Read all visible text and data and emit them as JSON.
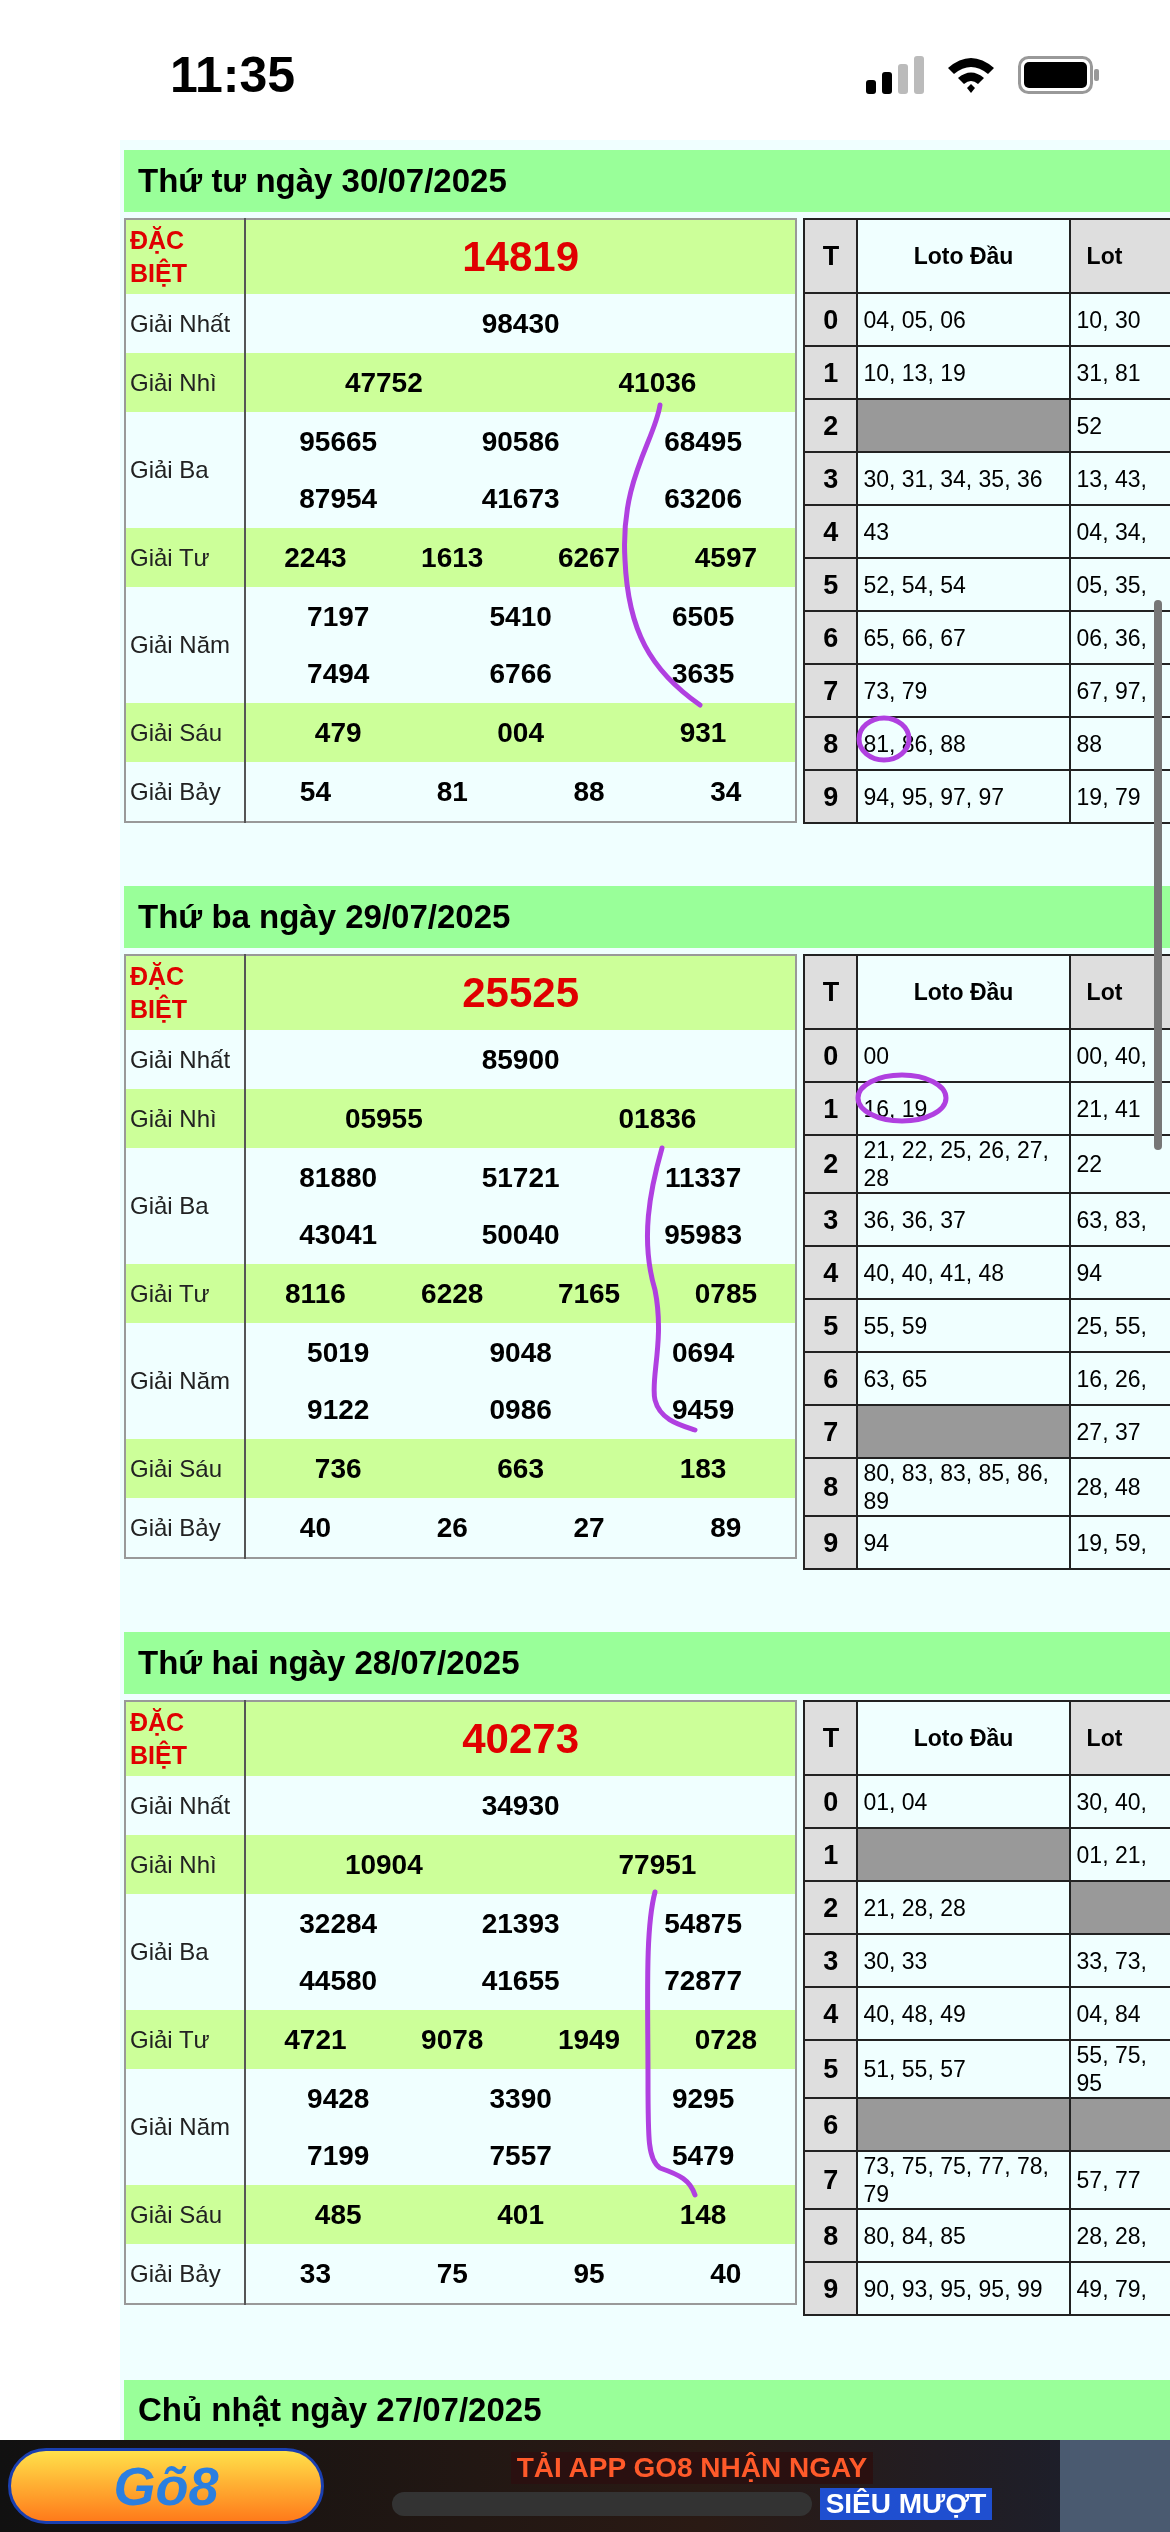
{
  "status_bar": {
    "time": "11:35"
  },
  "sections": [
    {
      "date": "Thứ tư ngày 30/07/2025",
      "prizes": [
        {
          "kind": "special",
          "label": "ĐẶC BIỆT",
          "numbers": [
            "14819"
          ]
        },
        {
          "kind": "normal",
          "label": "Giải Nhất",
          "numbers": [
            "98430"
          ]
        },
        {
          "kind": "normal",
          "label": "Giải Nhì",
          "numbers": [
            "47752",
            "41036"
          ]
        },
        {
          "kind": "normal",
          "label": "Giải Ba",
          "numbers": [
            "95665",
            "90586",
            "68495",
            "87954",
            "41673",
            "63206"
          ]
        },
        {
          "kind": "normal",
          "label": "Giải Tư",
          "numbers": [
            "2243",
            "1613",
            "6267",
            "4597"
          ]
        },
        {
          "kind": "normal",
          "label": "Giải Năm",
          "numbers": [
            "7197",
            "5410",
            "6505",
            "7494",
            "6766",
            "3635"
          ]
        },
        {
          "kind": "normal",
          "label": "Giải Sáu",
          "numbers": [
            "479",
            "004",
            "931"
          ]
        },
        {
          "kind": "normal",
          "label": "Giải Bảy",
          "numbers": [
            "54",
            "81",
            "88",
            "34"
          ]
        }
      ],
      "loto": {
        "columns": [
          "T",
          "Loto Đầu",
          "Lot"
        ],
        "rows": [
          {
            "t": "0",
            "head": "04, 05, 06",
            "tail": [
              "10, 30"
            ]
          },
          {
            "t": "1",
            "head": "10, 13, 19",
            "tail": [
              "31, 81"
            ]
          },
          {
            "t": "2",
            "tail": [
              "52"
            ]
          },
          {
            "t": "3",
            "head": "30, 31, 34, 35, 36",
            "tail": [
              "13, 43,"
            ]
          },
          {
            "t": "4",
            "head": "43",
            "tail": [
              "04, 34,"
            ]
          },
          {
            "t": "5",
            "head": "52, 54, 54",
            "tail": [
              "05, 35,"
            ]
          },
          {
            "t": "6",
            "head": "65, 66, 67",
            "tail": [
              "06, 36,"
            ]
          },
          {
            "t": "7",
            "head": "73, 79",
            "tail": [
              "67, 97,"
            ]
          },
          {
            "t": "8",
            "head": "81, 86, 88",
            "tail": [
              "88"
            ]
          },
          {
            "t": "9",
            "head": "94, 95, 97, 97",
            "tail": [
              "19, 79"
            ]
          }
        ]
      }
    },
    {
      "date": "Thứ ba ngày 29/07/2025",
      "prizes": [
        {
          "kind": "special",
          "label": "ĐẶC BIỆT",
          "numbers": [
            "25525"
          ]
        },
        {
          "kind": "normal",
          "label": "Giải Nhất",
          "numbers": [
            "85900"
          ]
        },
        {
          "kind": "normal",
          "label": "Giải Nhì",
          "numbers": [
            "05955",
            "01836"
          ]
        },
        {
          "kind": "normal",
          "label": "Giải Ba",
          "numbers": [
            "81880",
            "51721",
            "11337",
            "43041",
            "50040",
            "95983"
          ]
        },
        {
          "kind": "normal",
          "label": "Giải Tư",
          "numbers": [
            "8116",
            "6228",
            "7165",
            "0785"
          ]
        },
        {
          "kind": "normal",
          "label": "Giải Năm",
          "numbers": [
            "5019",
            "9048",
            "0694",
            "9122",
            "0986",
            "9459"
          ]
        },
        {
          "kind": "normal",
          "label": "Giải Sáu",
          "numbers": [
            "736",
            "663",
            "183"
          ]
        },
        {
          "kind": "normal",
          "label": "Giải Bảy",
          "numbers": [
            "40",
            "26",
            "27",
            "89"
          ]
        }
      ],
      "loto": {
        "columns": [
          "T",
          "Loto Đầu",
          "Lot"
        ],
        "rows": [
          {
            "t": "0",
            "head": "00",
            "tail": [
              "00, 40,"
            ]
          },
          {
            "t": "1",
            "head": "16, 19",
            "tail": [
              "21, 41"
            ]
          },
          {
            "t": "2",
            "head": "21, 22, 25, 26, 27, 28",
            "tail": [
              "22"
            ]
          },
          {
            "t": "3",
            "head": "36, 36, 37",
            "tail": [
              "63, 83,"
            ]
          },
          {
            "t": "4",
            "head": "40, 40, 41, 48",
            "tail": [
              "94"
            ]
          },
          {
            "t": "5",
            "head": "55, 59",
            "tail": [
              "25, 55,"
            ]
          },
          {
            "t": "6",
            "head": "63, 65",
            "tail": [
              "16, 26,"
            ]
          },
          {
            "t": "7",
            "tail": [
              "27, 37"
            ]
          },
          {
            "t": "8",
            "head": "80, 83, 83, 85, 86, 89",
            "tail": [
              "28, 48"
            ]
          },
          {
            "t": "9",
            "head": "94",
            "tail": [
              "19, 59,"
            ]
          }
        ]
      }
    },
    {
      "date": "Thứ hai ngày 28/07/2025",
      "prizes": [
        {
          "kind": "special",
          "label": "ĐẶC BIỆT",
          "numbers": [
            "40273"
          ]
        },
        {
          "kind": "normal",
          "label": "Giải Nhất",
          "numbers": [
            "34930"
          ]
        },
        {
          "kind": "normal",
          "label": "Giải Nhì",
          "numbers": [
            "10904",
            "77951"
          ]
        },
        {
          "kind": "normal",
          "label": "Giải Ba",
          "numbers": [
            "32284",
            "21393",
            "54875",
            "44580",
            "41655",
            "72877"
          ]
        },
        {
          "kind": "normal",
          "label": "Giải Tư",
          "numbers": [
            "4721",
            "9078",
            "1949",
            "0728"
          ]
        },
        {
          "kind": "normal",
          "label": "Giải Năm",
          "numbers": [
            "9428",
            "3390",
            "9295",
            "7199",
            "7557",
            "5479"
          ]
        },
        {
          "kind": "normal",
          "label": "Giải Sáu",
          "numbers": [
            "485",
            "401",
            "148"
          ]
        },
        {
          "kind": "normal",
          "label": "Giải Bảy",
          "numbers": [
            "33",
            "75",
            "95",
            "40"
          ]
        }
      ],
      "loto": {
        "columns": [
          "T",
          "Loto Đầu",
          "Lot"
        ],
        "rows": [
          {
            "t": "0",
            "head": "01, 04",
            "tail": [
              "30, 40,"
            ]
          },
          {
            "t": "1",
            "tail": [
              "01, 21,"
            ]
          },
          {
            "t": "2",
            "head": "21, 28, 28"
          },
          {
            "t": "3",
            "head": "30, 33",
            "tail": [
              "33, 73,"
            ]
          },
          {
            "t": "4",
            "head": "40, 48, 49",
            "tail": [
              "04, 84"
            ]
          },
          {
            "t": "5",
            "head": "51, 55, 57",
            "tail": [
              "55, 75,",
              "95"
            ]
          },
          {
            "t": "6"
          },
          {
            "t": "7",
            "head": "73, 75, 75, 77, 78, 79",
            "tail": [
              "57, 77"
            ]
          },
          {
            "t": "8",
            "head": "80, 84, 85",
            "tail": [
              "28, 28,"
            ]
          },
          {
            "t": "9",
            "head": "90, 93, 95, 95, 99",
            "tail": [
              "49, 79,"
            ]
          }
        ]
      }
    }
  ],
  "next_section": {
    "date": "Chủ nhật ngày 27/07/2025"
  },
  "ad_banner": {
    "logo": "Gõ8",
    "headline": "TẢI APP GO8 NHẬN NGAY",
    "tagline": "SIÊU MƯỢT"
  }
}
